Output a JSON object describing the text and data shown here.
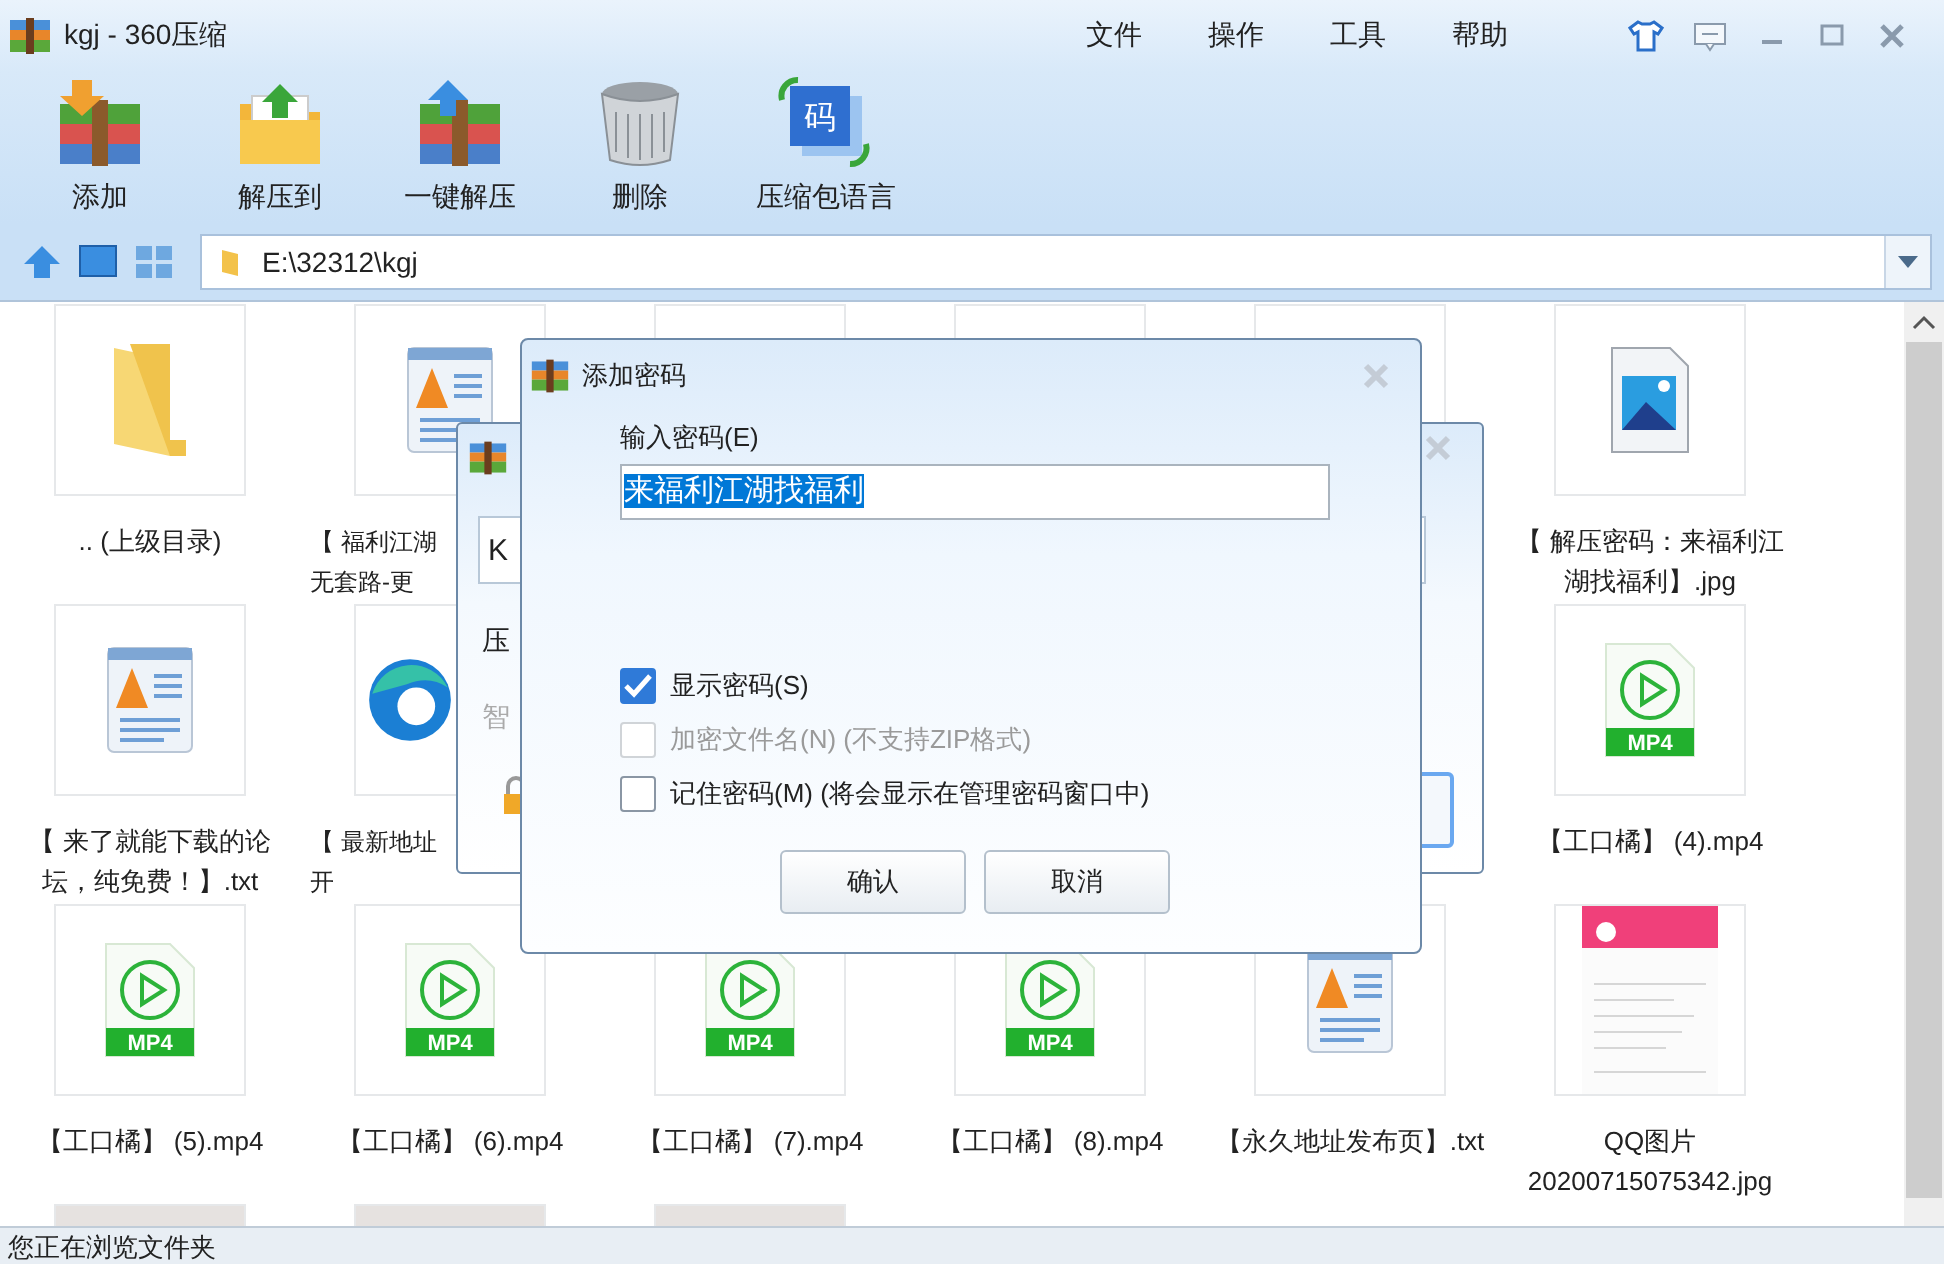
{
  "window": {
    "title": "kgj - 360压缩"
  },
  "menu": [
    "文件",
    "操作",
    "工具",
    "帮助"
  ],
  "toolbar": [
    {
      "kind": "add",
      "label": "添加"
    },
    {
      "kind": "extract",
      "label": "解压到"
    },
    {
      "kind": "oneclick",
      "label": "一键解压"
    },
    {
      "kind": "delete",
      "label": "删除"
    },
    {
      "kind": "language",
      "label": "压缩包语言",
      "icon_text": "码"
    }
  ],
  "address": {
    "path": "E:\\32312\\kgj"
  },
  "files": [
    {
      "kind": "folder",
      "lines": [
        ".. (上级目录)"
      ]
    },
    {
      "kind": "txt",
      "lines": [
        "【 福利江湖",
        "无套路-更"
      ],
      "clipped": true
    },
    {
      "kind": "blank"
    },
    {
      "kind": "blank"
    },
    {
      "kind": "blank"
    },
    {
      "kind": "image",
      "lines": [
        "【 解压密码：来福利江",
        "湖找福利】.jpg"
      ]
    },
    {
      "kind": "txt",
      "lines": [
        "【 来了就能下载的论",
        "坛，纯免费！】.txt"
      ]
    },
    {
      "kind": "edge",
      "lines": [
        "【 最新地址",
        "开"
      ],
      "clipped": true
    },
    {
      "kind": "blank"
    },
    {
      "kind": "blank"
    },
    {
      "kind": "blank"
    },
    {
      "kind": "mp4",
      "badge": "MP4",
      "lines": [
        "【工口橘】 (4).mp4"
      ]
    },
    {
      "kind": "mp4",
      "badge": "MP4",
      "lines": [
        "【工口橘】 (5).mp4"
      ]
    },
    {
      "kind": "mp4",
      "badge": "MP4",
      "lines": [
        "【工口橘】 (6).mp4"
      ]
    },
    {
      "kind": "mp4",
      "badge": "MP4",
      "lines": [
        "【工口橘】 (7).mp4"
      ]
    },
    {
      "kind": "mp4",
      "badge": "MP4",
      "lines": [
        "【工口橘】 (8).mp4"
      ]
    },
    {
      "kind": "txt",
      "lines": [
        "【永久地址发布页】.txt"
      ]
    },
    {
      "kind": "qq",
      "lines": [
        "QQ图片",
        "20200715075342.jpg"
      ]
    },
    {
      "kind": "photo"
    },
    {
      "kind": "photo"
    },
    {
      "kind": "photo"
    }
  ],
  "back_dialog": {
    "field_value": "K",
    "label": "压",
    "hint": "智"
  },
  "dialog": {
    "title": "添加密码",
    "password_label": "输入密码(E)",
    "password_value": "来福利江湖找福利",
    "password_selected": true,
    "options": [
      {
        "label": "显示密码(S)",
        "checked": true,
        "disabled": false
      },
      {
        "label": "加密文件名(N) (不支持ZIP格式)",
        "checked": false,
        "disabled": true
      },
      {
        "label": "记住密码(M) (将会显示在管理密码窗口中)",
        "checked": false,
        "disabled": false
      }
    ],
    "buttons": [
      "确认",
      "取消"
    ]
  },
  "status_bar": "您正在浏览文件夹"
}
